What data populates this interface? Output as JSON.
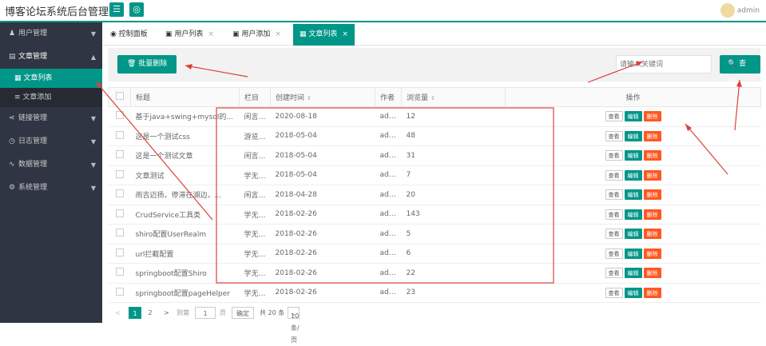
{
  "header": {
    "title": "博客论坛系统后台管理",
    "user": "admin"
  },
  "sidebar": {
    "groups": [
      {
        "label": "用户管理",
        "icon": "user-icon"
      },
      {
        "label": "文章管理",
        "icon": "article-icon",
        "expanded": true,
        "children": [
          {
            "label": "文章列表",
            "active": true
          },
          {
            "label": "文章添加"
          }
        ]
      },
      {
        "label": "链接管理",
        "icon": "share-icon"
      },
      {
        "label": "日志管理",
        "icon": "log-icon"
      },
      {
        "label": "数据管理",
        "icon": "data-icon"
      },
      {
        "label": "系统管理",
        "icon": "settings-icon"
      }
    ]
  },
  "tabs": [
    {
      "label": "控制面板"
    },
    {
      "label": "用户列表"
    },
    {
      "label": "用户添加"
    },
    {
      "label": "文章列表",
      "active": true
    }
  ],
  "toolbar": {
    "batch_delete": "批量删除",
    "search_placeholder": "请输入关键词",
    "search_button": "查询"
  },
  "table": {
    "headers": {
      "title": "标题",
      "column": "栏目",
      "created": "创建时间",
      "author": "作者",
      "views": "浏览量",
      "actions": "操作"
    },
    "rows": [
      {
        "title": "基于java+swing+mysql的...",
        "column": "闲言碎语",
        "date": "2020-08-18",
        "author": "admin",
        "views": "12"
      },
      {
        "title": "这是一个测试css",
        "column": "游览文字",
        "date": "2018-05-04",
        "author": "admin",
        "views": "48"
      },
      {
        "title": "这是一个测试文章",
        "column": "闲言碎语",
        "date": "2018-05-04",
        "author": "admin",
        "views": "31"
      },
      {
        "title": "文章测试",
        "column": "学无止境",
        "date": "2018-05-04",
        "author": "admin",
        "views": "7"
      },
      {
        "title": "雨吉迈扬，停滞在湖边，...",
        "column": "闲言碎语",
        "date": "2018-04-28",
        "author": "admin",
        "views": "20"
      },
      {
        "title": "CrudService工具类",
        "column": "学无止境",
        "date": "2018-02-26",
        "author": "admin",
        "views": "143"
      },
      {
        "title": "shiro配置UserRealm",
        "column": "学无止境",
        "date": "2018-02-26",
        "author": "admin",
        "views": "5"
      },
      {
        "title": "url拦截配置",
        "column": "学无止境",
        "date": "2018-02-26",
        "author": "admin",
        "views": "6"
      },
      {
        "title": "springboot配置Shiro",
        "column": "学无止境",
        "date": "2018-02-26",
        "author": "admin",
        "views": "22"
      },
      {
        "title": "springboot配置pageHelper",
        "column": "学无止境",
        "date": "2018-02-26",
        "author": "admin",
        "views": "23"
      }
    ],
    "row_actions": {
      "view": "查看",
      "edit": "编辑",
      "delete": "删除"
    }
  },
  "pager": {
    "prev": "<",
    "pages": [
      "1",
      "2"
    ],
    "next": ">",
    "goto": "到第",
    "page_value": "1",
    "page_unit": "页",
    "confirm": "确定",
    "total": "共 20 条",
    "per_page": "10 条/页"
  },
  "colors": {
    "accent": "#009688",
    "danger": "#ff5722",
    "sidebar": "#2f3542",
    "annotation": "#d9423a"
  }
}
